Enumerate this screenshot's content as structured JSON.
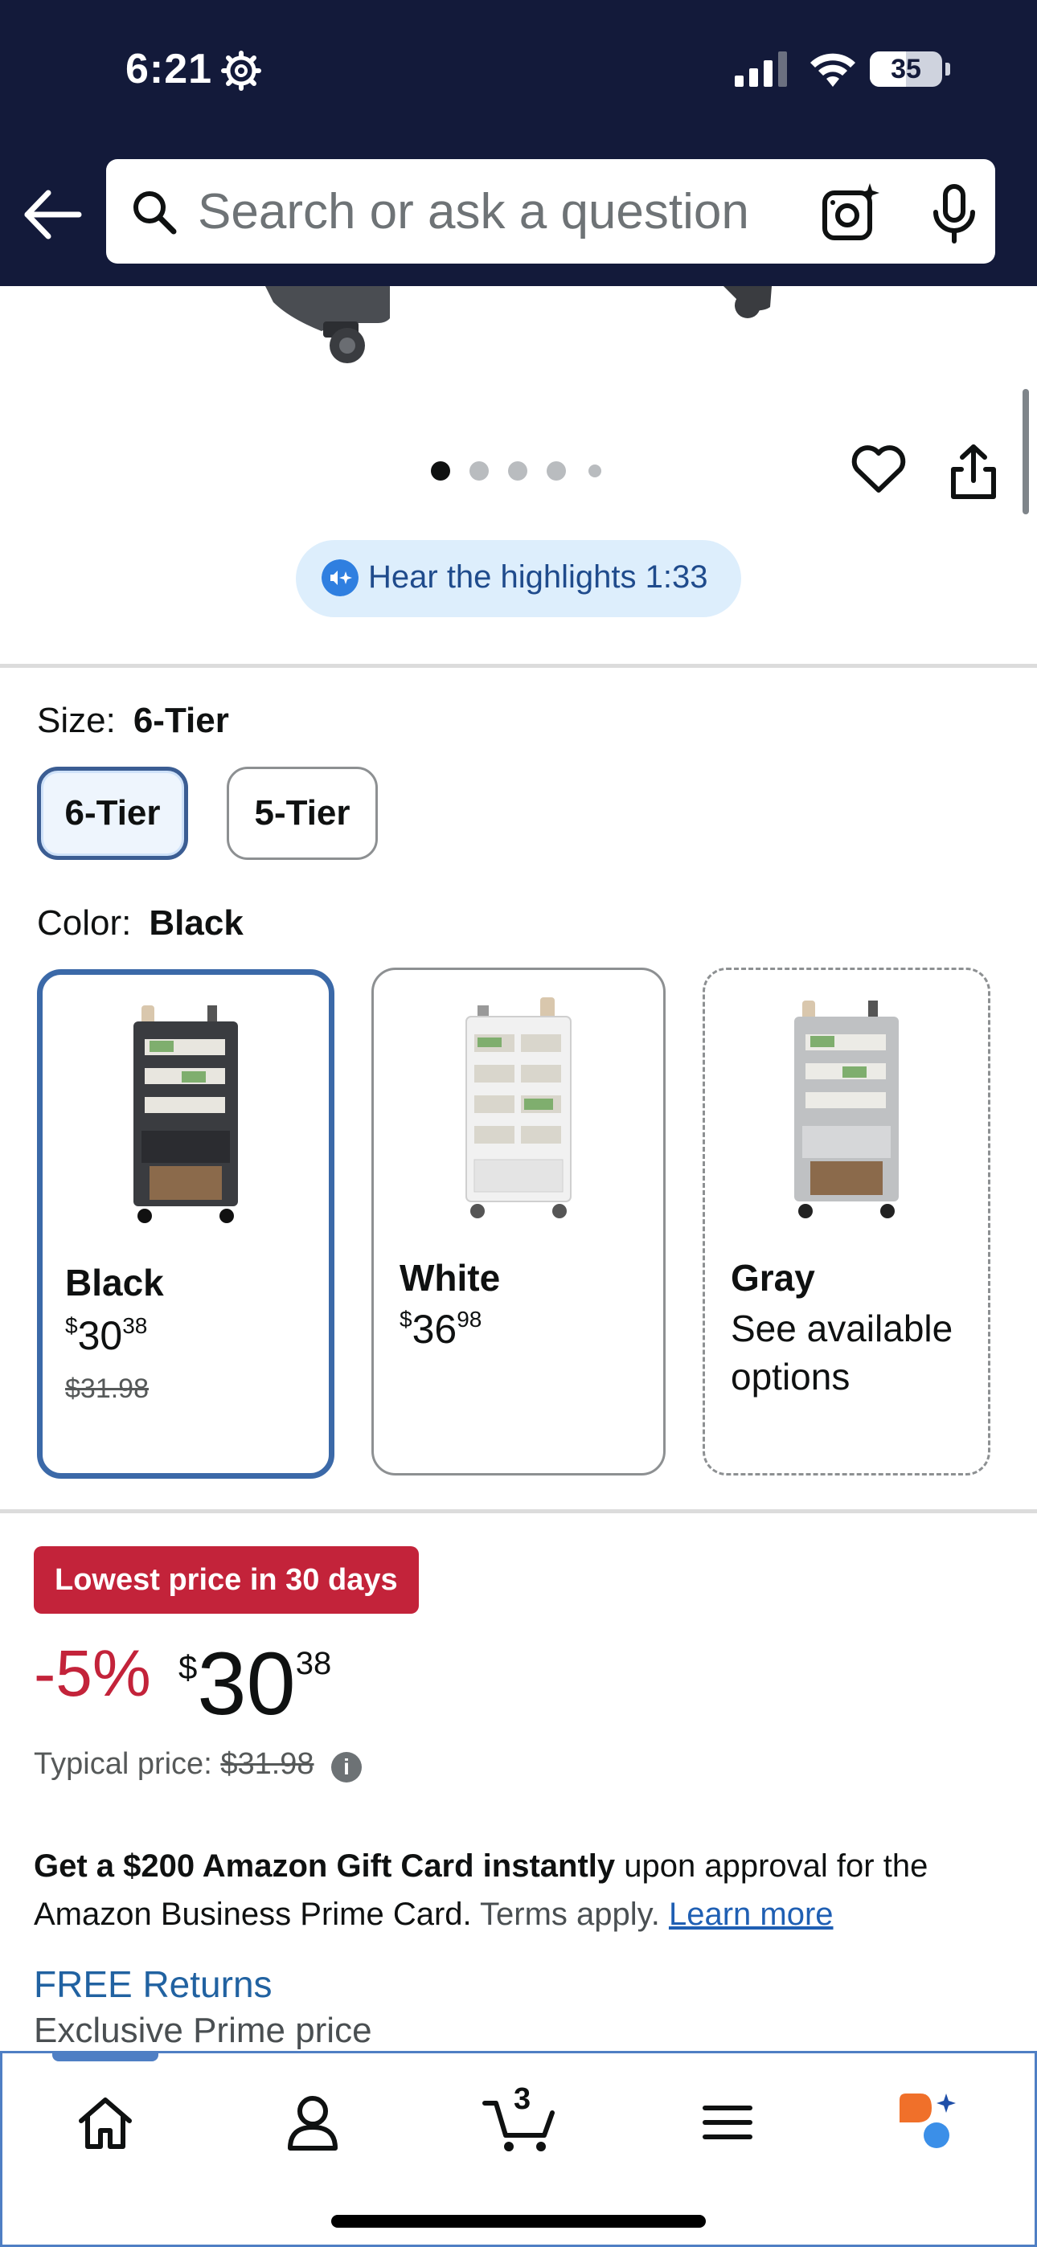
{
  "status_bar": {
    "time": "6:21",
    "battery": "35"
  },
  "header": {
    "search_placeholder": "Search or ask a question"
  },
  "gallery": {
    "image_count": 5,
    "active_index": 0
  },
  "audio": {
    "label": "Hear the highlights 1:33"
  },
  "size": {
    "label": "Size:",
    "selected": "6-Tier",
    "options": [
      "6-Tier",
      "5-Tier"
    ]
  },
  "color": {
    "label": "Color:",
    "selected": "Black",
    "options": [
      {
        "name": "Black",
        "price_whole": "30",
        "price_frac": "38",
        "currency": "$",
        "was": "$31.98"
      },
      {
        "name": "White",
        "price_whole": "36",
        "price_frac": "98",
        "currency": "$"
      },
      {
        "name": "Gray",
        "note": "See available options"
      }
    ]
  },
  "price": {
    "badge": "Lowest price in 30 days",
    "discount": "-5%",
    "currency": "$",
    "whole": "30",
    "fraction": "38",
    "typical_label": "Typical price:",
    "typical_value": "$31.98",
    "info_glyph": "i"
  },
  "promo": {
    "bold": "Get a $200 Amazon Gift Card instantly",
    "text": " upon approval for the Amazon Business Prime Card.",
    "terms": " Terms apply.",
    "link": "Learn more"
  },
  "returns": {
    "free_returns": "FREE Returns",
    "prime_price": "Exclusive Prime price"
  },
  "bottom_nav": {
    "cart_count": "3",
    "icons": [
      "home-icon",
      "account-icon",
      "cart-icon",
      "menu-icon",
      "rufus-assistant-icon"
    ]
  },
  "colors": {
    "header_bg": "#131a3a",
    "deal_red": "#c3233a",
    "link_blue": "#2162a1",
    "selected_border": "#3b69a8"
  }
}
